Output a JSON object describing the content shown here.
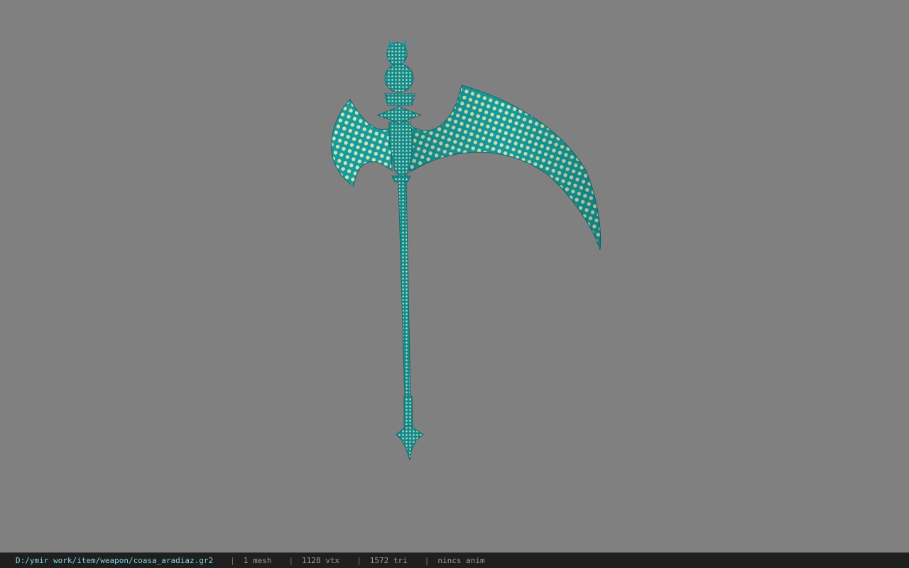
{
  "viewport": {
    "background_color": "#808080",
    "model": {
      "name": "scythe-model",
      "base_color": "#1a9a9a",
      "dot_color": "#c8e6b8",
      "shadow_color": "#0e6b6e"
    }
  },
  "status_bar": {
    "file_path": "D:/ymir work/item/weapon/coasa_aradiaz.gr2",
    "separator": "|",
    "mesh_count": "1 mesh",
    "vertex_count": "1128 vtx",
    "triangle_count": "1572 tri",
    "anim_status": "nincs anim"
  }
}
